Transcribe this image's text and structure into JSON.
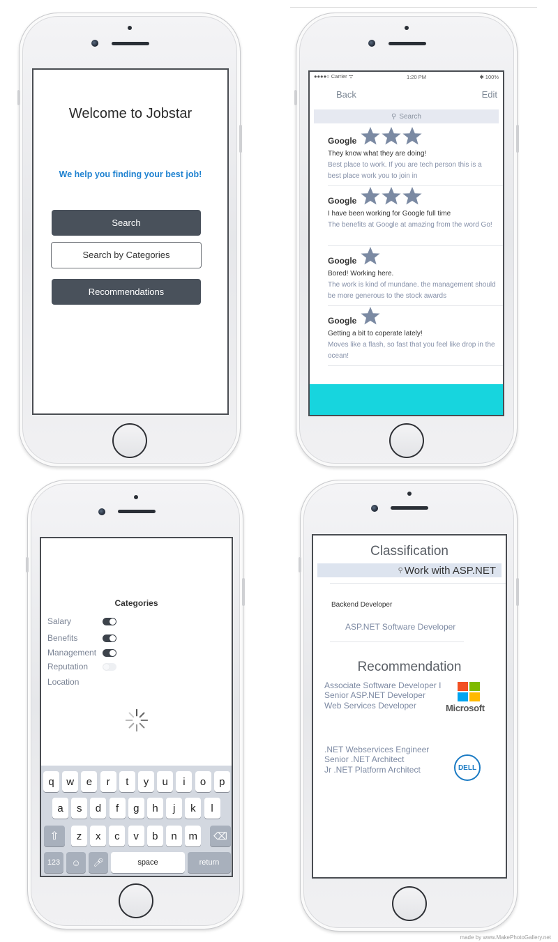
{
  "phone1": {
    "title": "Welcome to Jobstar",
    "tagline": "We help you finding your best job!",
    "buttons": {
      "search": "Search",
      "search_by_categories": "Search by Categories",
      "recommendations": "Recommendations"
    }
  },
  "phone2": {
    "status": {
      "carrier": "●●●●○ Carrier ᯤ",
      "time": "1:20 PM",
      "battery": "✱ 100%"
    },
    "nav": {
      "back": "Back",
      "edit": "Edit"
    },
    "search_placeholder": "Search",
    "reviews": [
      {
        "company": "Google",
        "stars": 3,
        "headline": "They know what they are doing!",
        "body": "Best place to work. If you are tech person this is a best place work you to join in"
      },
      {
        "company": "Google",
        "stars": 3,
        "headline": "I have been working for Google full time",
        "body": "The benefits at Google at amazing from the word Go!"
      },
      {
        "company": "Google",
        "stars": 1,
        "headline": "Bored! Working here.",
        "body": "The work is kind of mundane. the management should be more generous to the stock awards"
      },
      {
        "company": "Google",
        "stars": 1,
        "headline": "Getting a bit to coperate lately!",
        "body": "Moves like a flash, so fast that you feel like drop in the ocean!"
      }
    ],
    "accent_color": "#17d5de"
  },
  "phone3": {
    "title": "Categories",
    "categories": [
      {
        "label": "Salary",
        "toggle": "on"
      },
      {
        "label": "Benefits",
        "toggle": "on"
      },
      {
        "label": "Management",
        "toggle": "on"
      },
      {
        "label": "Reputation",
        "toggle": "off"
      },
      {
        "label": "Location",
        "toggle": "none"
      }
    ],
    "keyboard": {
      "row1": [
        "q",
        "w",
        "e",
        "r",
        "t",
        "y",
        "u",
        "i",
        "o",
        "p"
      ],
      "row2": [
        "a",
        "s",
        "d",
        "f",
        "g",
        "h",
        "j",
        "k",
        "l"
      ],
      "row3": [
        "z",
        "x",
        "c",
        "v",
        "b",
        "n",
        "m"
      ],
      "numbers": "123",
      "space": "space",
      "return": "return"
    }
  },
  "phone4": {
    "title": "Classification",
    "search_text": "Work with ASP.NET",
    "category": "Backend Developer",
    "subcategory": "ASP.NET Software Developer",
    "rec_title": "Recommendation",
    "microsoft_jobs": [
      "Associate Software Developer I",
      "Senior ASP.NET Developer",
      "Web Services Developer"
    ],
    "microsoft_label": "Microsoft",
    "dell_jobs": [
      ".NET Webservices Engineer",
      "Senior .NET Architect",
      "Jr .NET Platform Architect"
    ],
    "dell_label": "DELL"
  },
  "credit": "made by www.MakePhotoGallery.net"
}
